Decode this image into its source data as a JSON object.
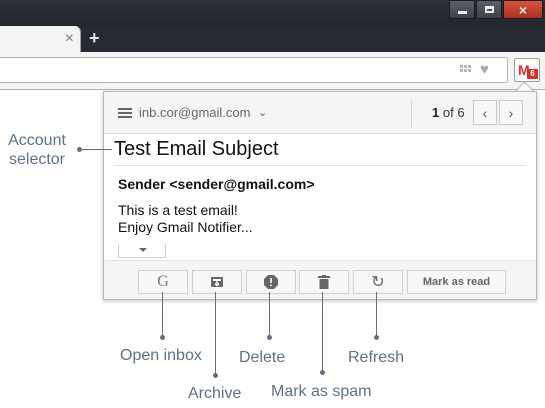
{
  "browser": {
    "tab_close": "×",
    "new_tab": "+",
    "window_controls": {
      "minimize": "minimize-icon",
      "maximize": "maximize-icon",
      "close": "×"
    },
    "extension_badge": "6"
  },
  "popup": {
    "account_email": "inb.cor@gmail.com",
    "pager_current": "1",
    "pager_of": "of 6",
    "prev_label": "‹",
    "next_label": "›",
    "subject": "Test Email Subject",
    "sender": "Sender <sender@gmail.com>",
    "body_lines": [
      "This is a test email!",
      "Enjoy Gmail Notifier..."
    ],
    "footer": {
      "open_inbox_glyph": "G",
      "refresh_glyph": "↻",
      "mark_as_read_label": "Mark as read"
    }
  },
  "callouts": {
    "account_selector": [
      "Account",
      "selector"
    ],
    "open_inbox": "Open inbox",
    "archive": "Archive",
    "delete": "Delete",
    "mark_as_spam": "Mark as spam",
    "refresh": "Refresh"
  },
  "colors": {
    "gmail_red": "#d93025",
    "callout": "#5e7185",
    "frame": "#262a31"
  }
}
